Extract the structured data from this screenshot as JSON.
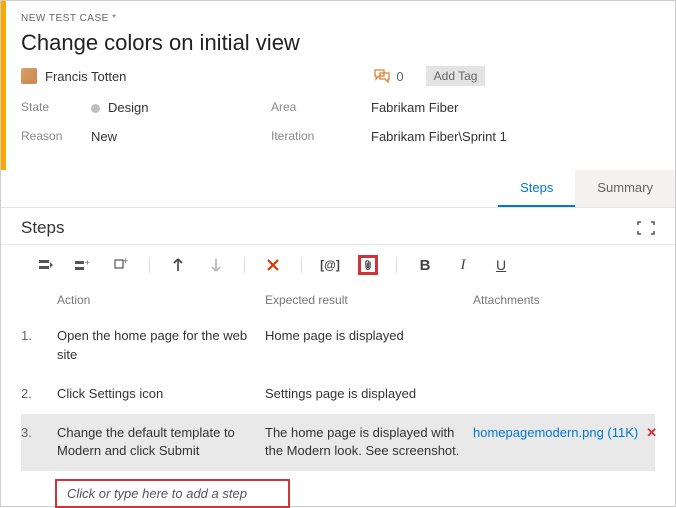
{
  "header": {
    "tab_label": "NEW TEST CASE *",
    "title": "Change colors on initial view",
    "assigned_to": "Francis Totten",
    "discussion_count": "0",
    "add_tag_label": "Add Tag"
  },
  "meta": {
    "state_label": "State",
    "state_value": "Design",
    "reason_label": "Reason",
    "reason_value": "New",
    "area_label": "Area",
    "area_value": "Fabrikam Fiber",
    "iteration_label": "Iteration",
    "iteration_value": "Fabrikam Fiber\\Sprint 1"
  },
  "tabs": {
    "steps": "Steps",
    "summary": "Summary"
  },
  "section": {
    "title": "Steps"
  },
  "columns": {
    "action": "Action",
    "expected": "Expected result",
    "attachments": "Attachments"
  },
  "rows": [
    {
      "num": "1.",
      "action": "Open the home page for the web site",
      "expected": "Home page is displayed",
      "attachment": ""
    },
    {
      "num": "2.",
      "action": "Click Settings icon",
      "expected": "Settings page is displayed",
      "attachment": ""
    },
    {
      "num": "3.",
      "action": "Change the default template to Modern and click Submit",
      "expected": "The home page is displayed with the Modern look. See screenshot.",
      "attachment": "homepagemodern.png (11K)"
    }
  ],
  "add_step_placeholder": "Click or type here to add a step"
}
